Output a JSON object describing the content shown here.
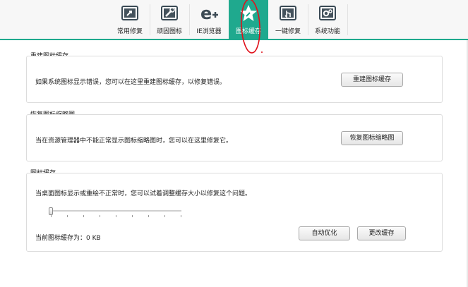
{
  "toolbar": {
    "tabs": [
      {
        "label": "常用修复",
        "icon": "common-repair-icon",
        "active": false
      },
      {
        "label": "顽固图标",
        "icon": "stubborn-icon-tool-icon",
        "active": false
      },
      {
        "label": "IE浏览器",
        "icon": "ie-browser-icon",
        "active": false
      },
      {
        "label": "图标缓存",
        "icon": "icon-cache-star-icon",
        "active": true
      },
      {
        "label": "一键修复",
        "icon": "one-click-repair-icon",
        "active": false
      },
      {
        "label": "系统功能",
        "icon": "system-gear-icon",
        "active": false
      }
    ],
    "accent": "#1fa98e"
  },
  "sections": {
    "rebuild": {
      "title": "重建图标缓存",
      "description": "如果系统图标显示错误，您可以在这里重建图标缓存，以修复错误。",
      "button": "重建图标缓存"
    },
    "thumbnail": {
      "title": "恢复图标缩略图",
      "description": "当在资源管理器中不能正常显示图标缩略图时，您可以在这里修复它。",
      "button": "恢复图标缩略图"
    },
    "cache": {
      "title": "图标缓存",
      "description": "当桌面图标显示或重绘不正常时，您可以试着调整缓存大小以修复这个问题。",
      "size_text": "当前图标缓存为：0 KB",
      "slider_value": 0,
      "auto_button": "自动优化",
      "change_button": "更改缓存"
    }
  },
  "annotation": {
    "color": "#e0101a"
  }
}
